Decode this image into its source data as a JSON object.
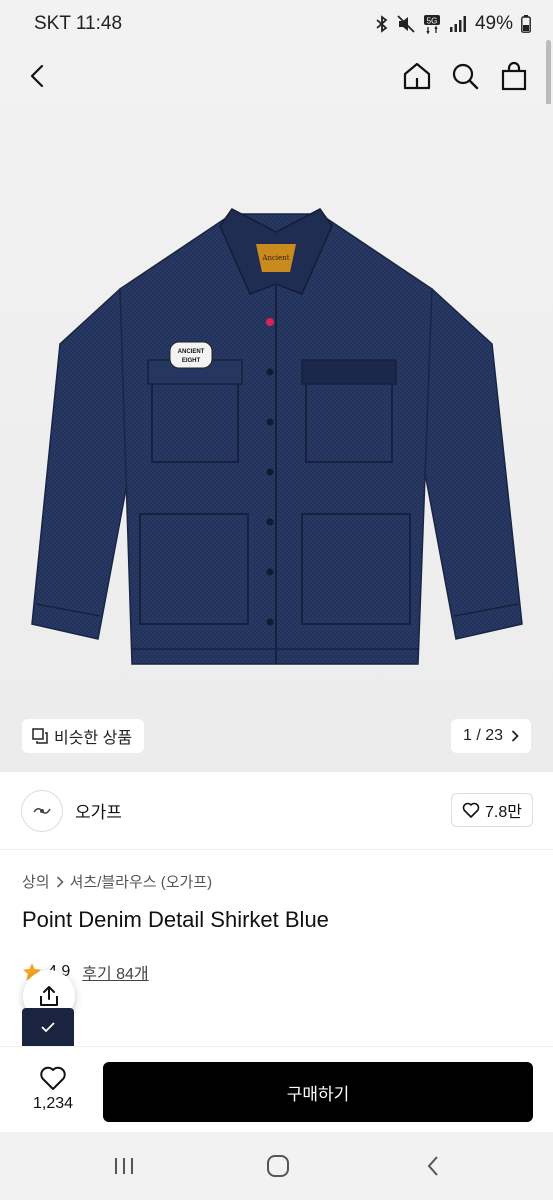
{
  "status_bar": {
    "carrier_time": "SKT 11:48",
    "battery": "49%",
    "network": "5G",
    "icons": [
      "bluetooth-icon",
      "mute-icon",
      "5g-icon",
      "signal-icon",
      "battery-icon"
    ]
  },
  "nav": {
    "icons": [
      "back-icon",
      "home-icon",
      "search-icon",
      "shopping-bag-icon"
    ]
  },
  "gallery": {
    "similar_label": "비슷한 상품",
    "page_counter": "1 / 23",
    "patch_text_1": "ANCIENT",
    "patch_text_2": "EIGHT",
    "label_text": "Ancient",
    "garment_color": "#22325a"
  },
  "brand": {
    "name": "오가프",
    "likes": "7.8만"
  },
  "product": {
    "breadcrumb": [
      "상의",
      "셔츠/블라우스 (오가프)"
    ],
    "title": "Point Denim Detail Shirket Blue",
    "rating": "4.9",
    "reviews": "후기 84개"
  },
  "bottom_bar": {
    "wishlist_count": "1,234",
    "buy_label": "구매하기"
  },
  "colors": {
    "accent": "#000000",
    "star": "#f5a623",
    "background": "#ffffff",
    "image_bg": "#f0f0f0"
  }
}
